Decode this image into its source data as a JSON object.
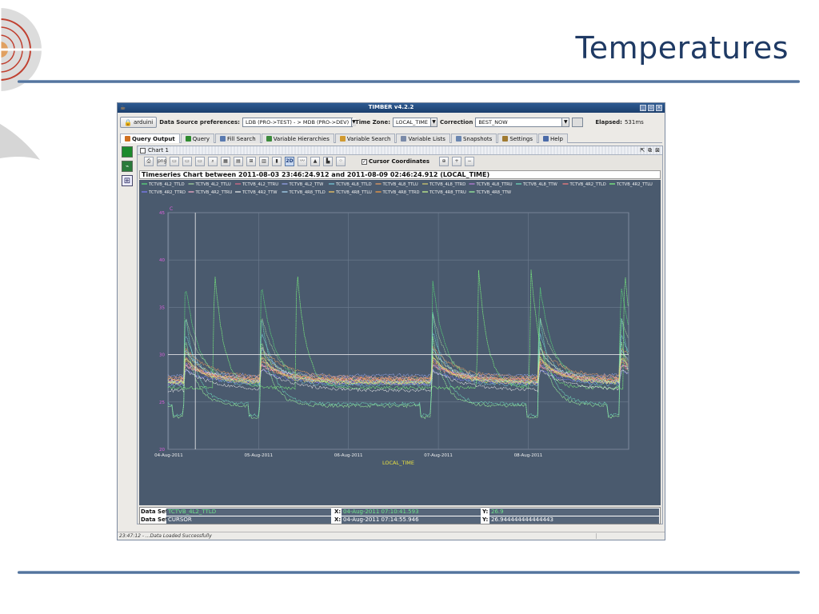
{
  "slide": {
    "title": "Temperatures"
  },
  "app": {
    "window_title": "TIMBER v4.2.2",
    "user_button": "arduini",
    "data_source_label": "Data Source preferences:",
    "data_source_value": "LDB (PRO->TEST) - > MDB (PRO->DEV)",
    "timezone_label": "Time Zone:",
    "timezone_value": "LOCAL_TIME",
    "correction_label": "Correction",
    "correction_value": "BEST_NOW",
    "elapsed_label": "Elapsed:",
    "elapsed_value": "531ms",
    "tabs": [
      {
        "label": "Query Output",
        "icon": "chart-icon",
        "color": "#d07020"
      },
      {
        "label": "Query",
        "icon": "play-icon",
        "color": "#2e8a2e"
      },
      {
        "label": "Fill Search",
        "icon": "search-icon",
        "color": "#5a7ab0"
      },
      {
        "label": "Variable Hierarchies",
        "icon": "hierarchy-icon",
        "color": "#3c8a3c"
      },
      {
        "label": "Variable Search",
        "icon": "pencil-icon",
        "color": "#d09a30"
      },
      {
        "label": "Variable Lists",
        "icon": "list-icon",
        "color": "#7a8aa8"
      },
      {
        "label": "Snapshots",
        "icon": "snapshot-icon",
        "color": "#6a86b0"
      },
      {
        "label": "Settings",
        "icon": "gear-icon",
        "color": "#a07a30"
      },
      {
        "label": "Help",
        "icon": "help-icon",
        "color": "#4a6aa8"
      }
    ],
    "chart_frame_title": "Chart 1",
    "cursor_coordinates_label": "Cursor Coordinates",
    "status_text": "23:47:12 - ...Data Loaded Successfully",
    "datasets": [
      {
        "label": "Data Set:",
        "name": "TCTVB_4L2_TTLD",
        "x_label": "X:",
        "x": "04-Aug-2011 07:10:41.593",
        "y_label": "Y:",
        "y": "26.9"
      },
      {
        "label": "Data Set:",
        "name": "CURSOR",
        "x_label": "X:",
        "x": "04-Aug-2011 07:14:55.946",
        "y_label": "Y:",
        "y": "26.944444444444443"
      }
    ]
  },
  "chart_data": {
    "type": "line",
    "title": "Timeseries Chart between 2011-08-03 23:46:24.912 and 2011-08-09 02:46:24.912 (LOCAL_TIME)",
    "xlabel": "LOCAL_TIME",
    "ylabel": "C",
    "ylim": [
      20,
      45
    ],
    "yticks": [
      20,
      25,
      30,
      35,
      40,
      45
    ],
    "x_ticks": [
      "04-Aug-2011",
      "05-Aug-2011",
      "06-Aug-2011",
      "07-Aug-2011",
      "08-Aug-2011"
    ],
    "x_range_hours": [
      0,
      123
    ],
    "x_tick_hours": [
      0.2,
      24.2,
      48.2,
      72.2,
      96.2
    ],
    "cursor": {
      "x_hours": 7.3,
      "y": 30.0
    },
    "grid": true,
    "legend_position": "top",
    "series": [
      {
        "name": "TCTVB_4L2_TTLD",
        "color": "#5ae07a",
        "base": 27.0,
        "peak": 39,
        "decay": 3.5,
        "peaks_at": [
          4.2,
          24.5,
          70.3,
          98.8,
          120.5
        ]
      },
      {
        "name": "TCTVB_4L2_TTLU",
        "color": "#a8d8a0",
        "base": 27.4,
        "peak": 35,
        "decay": 4,
        "peaks_at": [
          4.2,
          24.5,
          70.3,
          98.8,
          120.5
        ]
      },
      {
        "name": "TCTVB_4L2_TTRU",
        "color": "#e06a8a",
        "base": 27.2,
        "peak": 30,
        "decay": 5,
        "peaks_at": [
          4.2,
          24.5,
          70.3,
          98.8,
          120.5
        ]
      },
      {
        "name": "TCTVB_4L2_TTW",
        "color": "#9aa8f0",
        "base": 27.8,
        "peak": 29,
        "decay": 5,
        "peaks_at": [
          4.2,
          24.5,
          70.3,
          98.8,
          120.5
        ]
      },
      {
        "name": "TCTVB_4L8_TTLD",
        "color": "#7acfe0",
        "base": 26.8,
        "peak": 33,
        "decay": 4,
        "peaks_at": [
          4.2,
          24.5,
          70.3,
          98.8,
          120.5
        ]
      },
      {
        "name": "TCTVB_4L8_TTLU",
        "color": "#f0a060",
        "base": 27.6,
        "peak": 31,
        "decay": 6,
        "peaks_at": [
          4.2,
          24.5,
          70.3,
          98.8,
          120.5
        ]
      },
      {
        "name": "TCTVB_4L8_TTRD",
        "color": "#d8d070",
        "base": 27.1,
        "peak": 30.5,
        "decay": 6,
        "peaks_at": [
          4.2,
          24.5,
          70.3,
          98.8,
          120.5
        ]
      },
      {
        "name": "TCTVB_4L8_TTRU",
        "color": "#c080e0",
        "base": 26.9,
        "peak": 29.5,
        "decay": 7,
        "peaks_at": [
          4.2,
          24.5,
          70.3,
          98.8,
          120.5
        ]
      },
      {
        "name": "TCTVB_4L8_TTW",
        "color": "#70e0c0",
        "base": 24.8,
        "peak": 36,
        "decay": 3,
        "peaks_at": [
          4.2,
          24.5,
          70.3,
          98.8,
          120.5
        ]
      },
      {
        "name": "TCTVB_4R2_TTLD",
        "color": "#ff8080",
        "base": 27.3,
        "peak": 29,
        "decay": 6,
        "peaks_at": [
          4.2,
          24.5,
          70.3,
          98.8,
          120.5
        ]
      },
      {
        "name": "TCTVB_4R2_TTLU",
        "color": "#80ff80",
        "base": 26.5,
        "peak": 41.5,
        "decay": 2.5,
        "peaks_at": [
          12,
          34,
          82.5,
          96.5,
          121.5
        ]
      },
      {
        "name": "TCTVB_4R2_TTRD",
        "color": "#8080ff",
        "base": 27.0,
        "peak": 28.5,
        "decay": 6,
        "peaks_at": [
          4.2,
          24.5,
          70.3,
          98.8,
          120.5
        ]
      },
      {
        "name": "TCTVB_4R2_TTRU",
        "color": "#ffb0d0",
        "base": 27.5,
        "peak": 29,
        "decay": 6,
        "peaks_at": [
          4.2,
          24.5,
          70.3,
          98.8,
          120.5
        ]
      },
      {
        "name": "TCTVB_4R2_TTW",
        "color": "#f0f0f0",
        "base": 26.2,
        "peak": 28.5,
        "decay": 8,
        "peaks_at": [
          4.2,
          24.5,
          70.3,
          98.8,
          120.5
        ]
      },
      {
        "name": "TCTVB_4R8_TTLD",
        "color": "#b0e0ff",
        "base": 27.2,
        "peak": 31,
        "decay": 5,
        "peaks_at": [
          4.2,
          24.5,
          70.3,
          98.8,
          120.5
        ]
      },
      {
        "name": "TCTVB_4R8_TTLU",
        "color": "#ffd060",
        "base": 27.0,
        "peak": 30,
        "decay": 5,
        "peaks_at": [
          4.2,
          24.5,
          70.3,
          98.8,
          120.5
        ]
      },
      {
        "name": "TCTVB_4R8_TTRD",
        "color": "#ffa040",
        "base": 27.4,
        "peak": 29.5,
        "decay": 5,
        "peaks_at": [
          4.2,
          24.5,
          70.3,
          98.8,
          120.5
        ]
      },
      {
        "name": "TCTVB_4R8_TTRU",
        "color": "#d0ff90",
        "base": 27.1,
        "peak": 30,
        "decay": 5,
        "peaks_at": [
          4.2,
          24.5,
          70.3,
          98.8,
          120.5
        ]
      },
      {
        "name": "TCTVB_4R8_TTW",
        "color": "#a0ffa0",
        "base": 24.6,
        "peak": 33,
        "decay": 3,
        "peaks_at": [
          4.2,
          24.5,
          70.3,
          98.8,
          120.5
        ]
      }
    ]
  }
}
